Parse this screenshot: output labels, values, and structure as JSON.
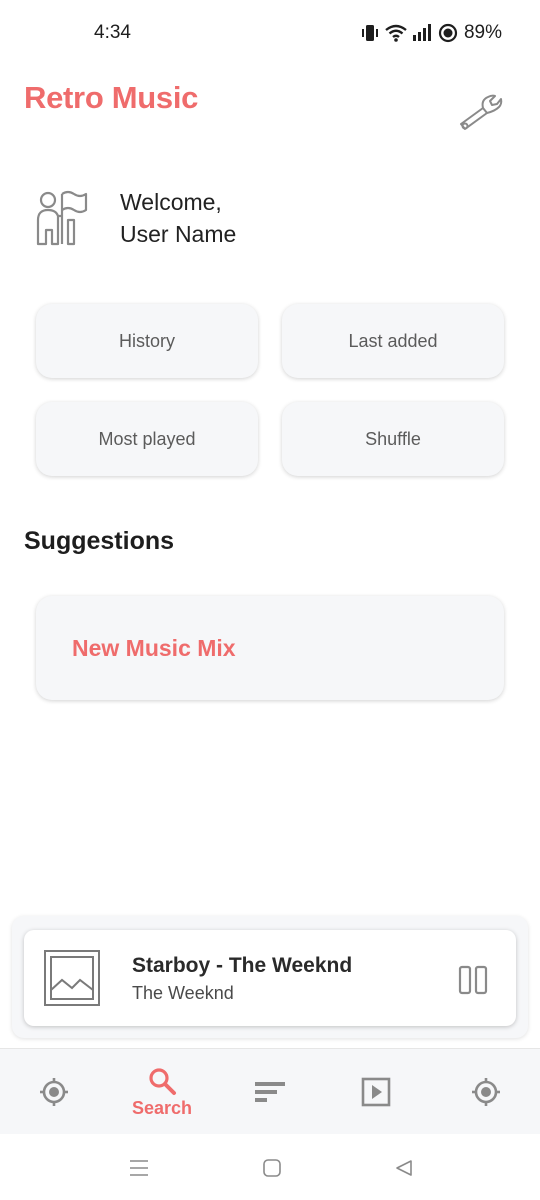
{
  "status_bar": {
    "time": "4:34",
    "battery": "89%"
  },
  "header": {
    "title": "Retro Music",
    "settings_icon": "wrench-icon"
  },
  "welcome": {
    "greeting": "Welcome,",
    "user_name": "User Name"
  },
  "quick_actions": [
    {
      "label": "History"
    },
    {
      "label": "Last added"
    },
    {
      "label": "Most played"
    },
    {
      "label": "Shuffle"
    }
  ],
  "suggestions": {
    "title": "Suggestions",
    "mix_title": "New Music Mix"
  },
  "mini_player": {
    "title": "Starboy - The Weeknd",
    "artist": "The Weeknd"
  },
  "bottom_nav": {
    "items": [
      {
        "icon": "for-you-icon",
        "label": ""
      },
      {
        "icon": "search-icon",
        "label": "Search"
      },
      {
        "icon": "songs-icon",
        "label": ""
      },
      {
        "icon": "playlist-icon",
        "label": ""
      },
      {
        "icon": "artist-icon",
        "label": ""
      }
    ],
    "active_index": 1
  },
  "colors": {
    "accent": "#ef6c6c",
    "card_bg": "#f6f7f9",
    "icon_gray": "#8a8a8a"
  }
}
